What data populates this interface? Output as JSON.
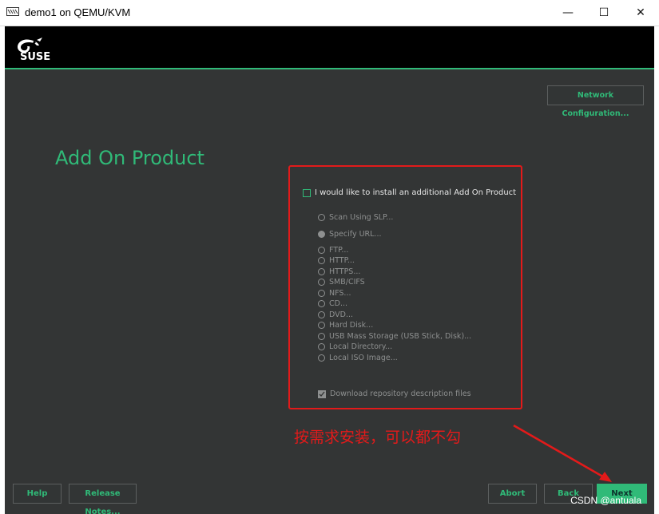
{
  "window": {
    "title": "demo1 on QEMU/KVM",
    "icon": "vm-monitor-icon",
    "controls": {
      "minimize": "—",
      "maximize": "☐",
      "close": "✕"
    }
  },
  "installer": {
    "brand": "SUSE",
    "accent_color": "#30ba78",
    "network_config_label": "Network Configuration...",
    "page_title": "Add On Product",
    "addon_checkbox": {
      "label": "I would like to install an additional Add On Product",
      "checked": false
    },
    "source_options": [
      {
        "label": "Scan Using SLP...",
        "selected": false
      },
      {
        "label": "Specify URL...",
        "selected": true
      },
      {
        "label": "FTP...",
        "selected": false
      },
      {
        "label": "HTTP...",
        "selected": false
      },
      {
        "label": "HTTPS...",
        "selected": false
      },
      {
        "label": "SMB/CIFS",
        "selected": false
      },
      {
        "label": "NFS...",
        "selected": false
      },
      {
        "label": "CD...",
        "selected": false
      },
      {
        "label": "DVD...",
        "selected": false
      },
      {
        "label": "Hard Disk...",
        "selected": false
      },
      {
        "label": "USB Mass Storage (USB Stick, Disk)...",
        "selected": false
      },
      {
        "label": "Local Directory...",
        "selected": false
      },
      {
        "label": "Local ISO Image...",
        "selected": false
      }
    ],
    "download_checkbox": {
      "label": "Download repository description files",
      "checked": true
    },
    "footer": {
      "help": "Help",
      "release_notes": "Release Notes...",
      "abort": "Abort",
      "back": "Back",
      "next": "Next"
    }
  },
  "annotation": {
    "text": "按需求安装，可以都不勾",
    "color": "#e31a1a"
  },
  "watermark": "CSDN @antuala"
}
